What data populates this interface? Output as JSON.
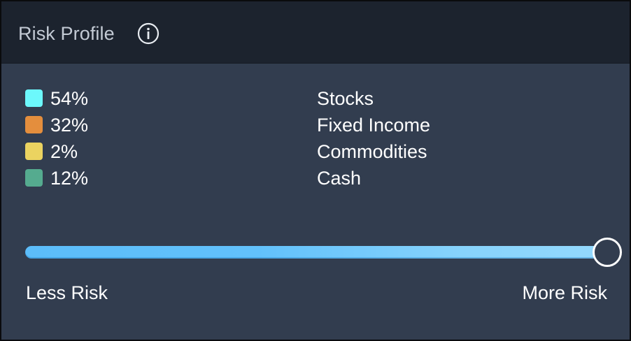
{
  "header": {
    "title": "Risk Profile",
    "info_icon": "info-circle-icon"
  },
  "allocation": [
    {
      "percent": "54%",
      "label": "Stocks",
      "color": "#6cf8fc"
    },
    {
      "percent": "32%",
      "label": "Fixed Income",
      "color": "#e48e3d"
    },
    {
      "percent": "2%",
      "label": "Commodities",
      "color": "#ebd360"
    },
    {
      "percent": "12%",
      "label": "Cash",
      "color": "#55ab8f"
    }
  ],
  "risk_slider": {
    "value": 1.0,
    "min_label": "Less Risk",
    "max_label": "More Risk",
    "track_color": "#5cbdfa"
  }
}
